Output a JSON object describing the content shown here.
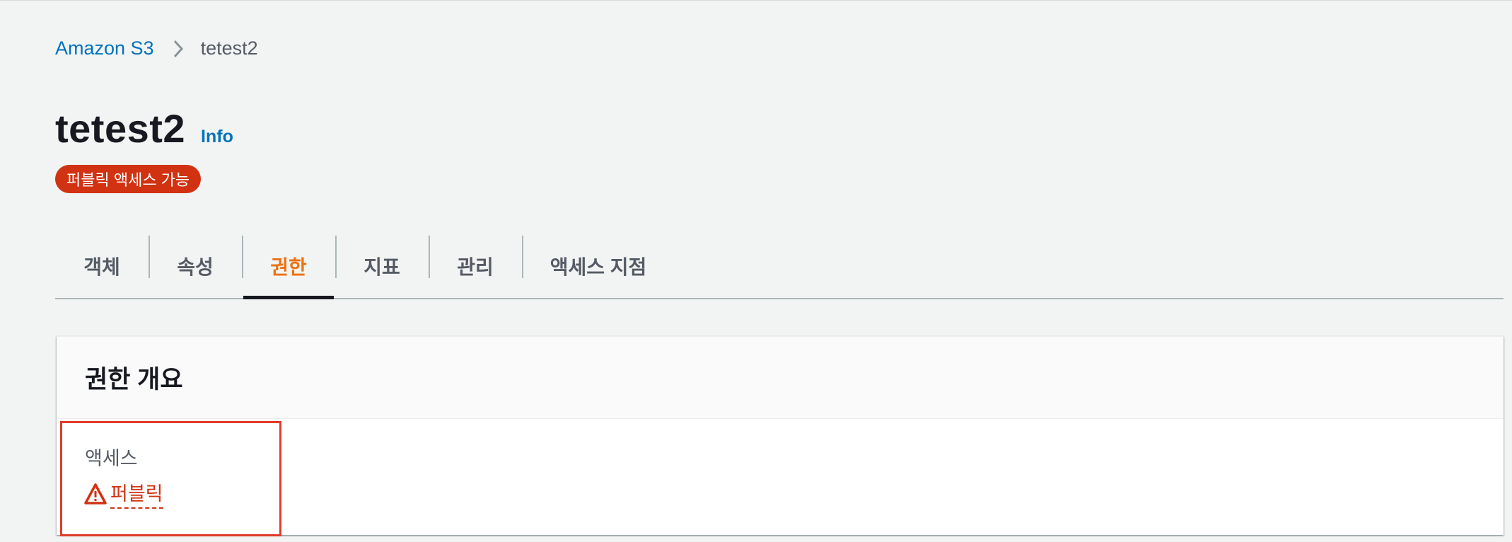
{
  "breadcrumb": {
    "root": "Amazon S3",
    "current": "tetest2"
  },
  "header": {
    "title": "tetest2",
    "info_label": "Info",
    "badge": "퍼블릭 액세스 가능"
  },
  "tabs": [
    {
      "label": "객체",
      "active": false
    },
    {
      "label": "속성",
      "active": false
    },
    {
      "label": "권한",
      "active": true
    },
    {
      "label": "지표",
      "active": false
    },
    {
      "label": "관리",
      "active": false
    },
    {
      "label": "액세스 지점",
      "active": false
    }
  ],
  "panel": {
    "title": "권한 개요",
    "access_label": "액세스",
    "access_value": "퍼블릭",
    "access_icon": "warning-icon"
  },
  "colors": {
    "link": "#0073bb",
    "active_tab": "#ec7211",
    "danger": "#d13212",
    "highlight": "#e03c2a"
  }
}
